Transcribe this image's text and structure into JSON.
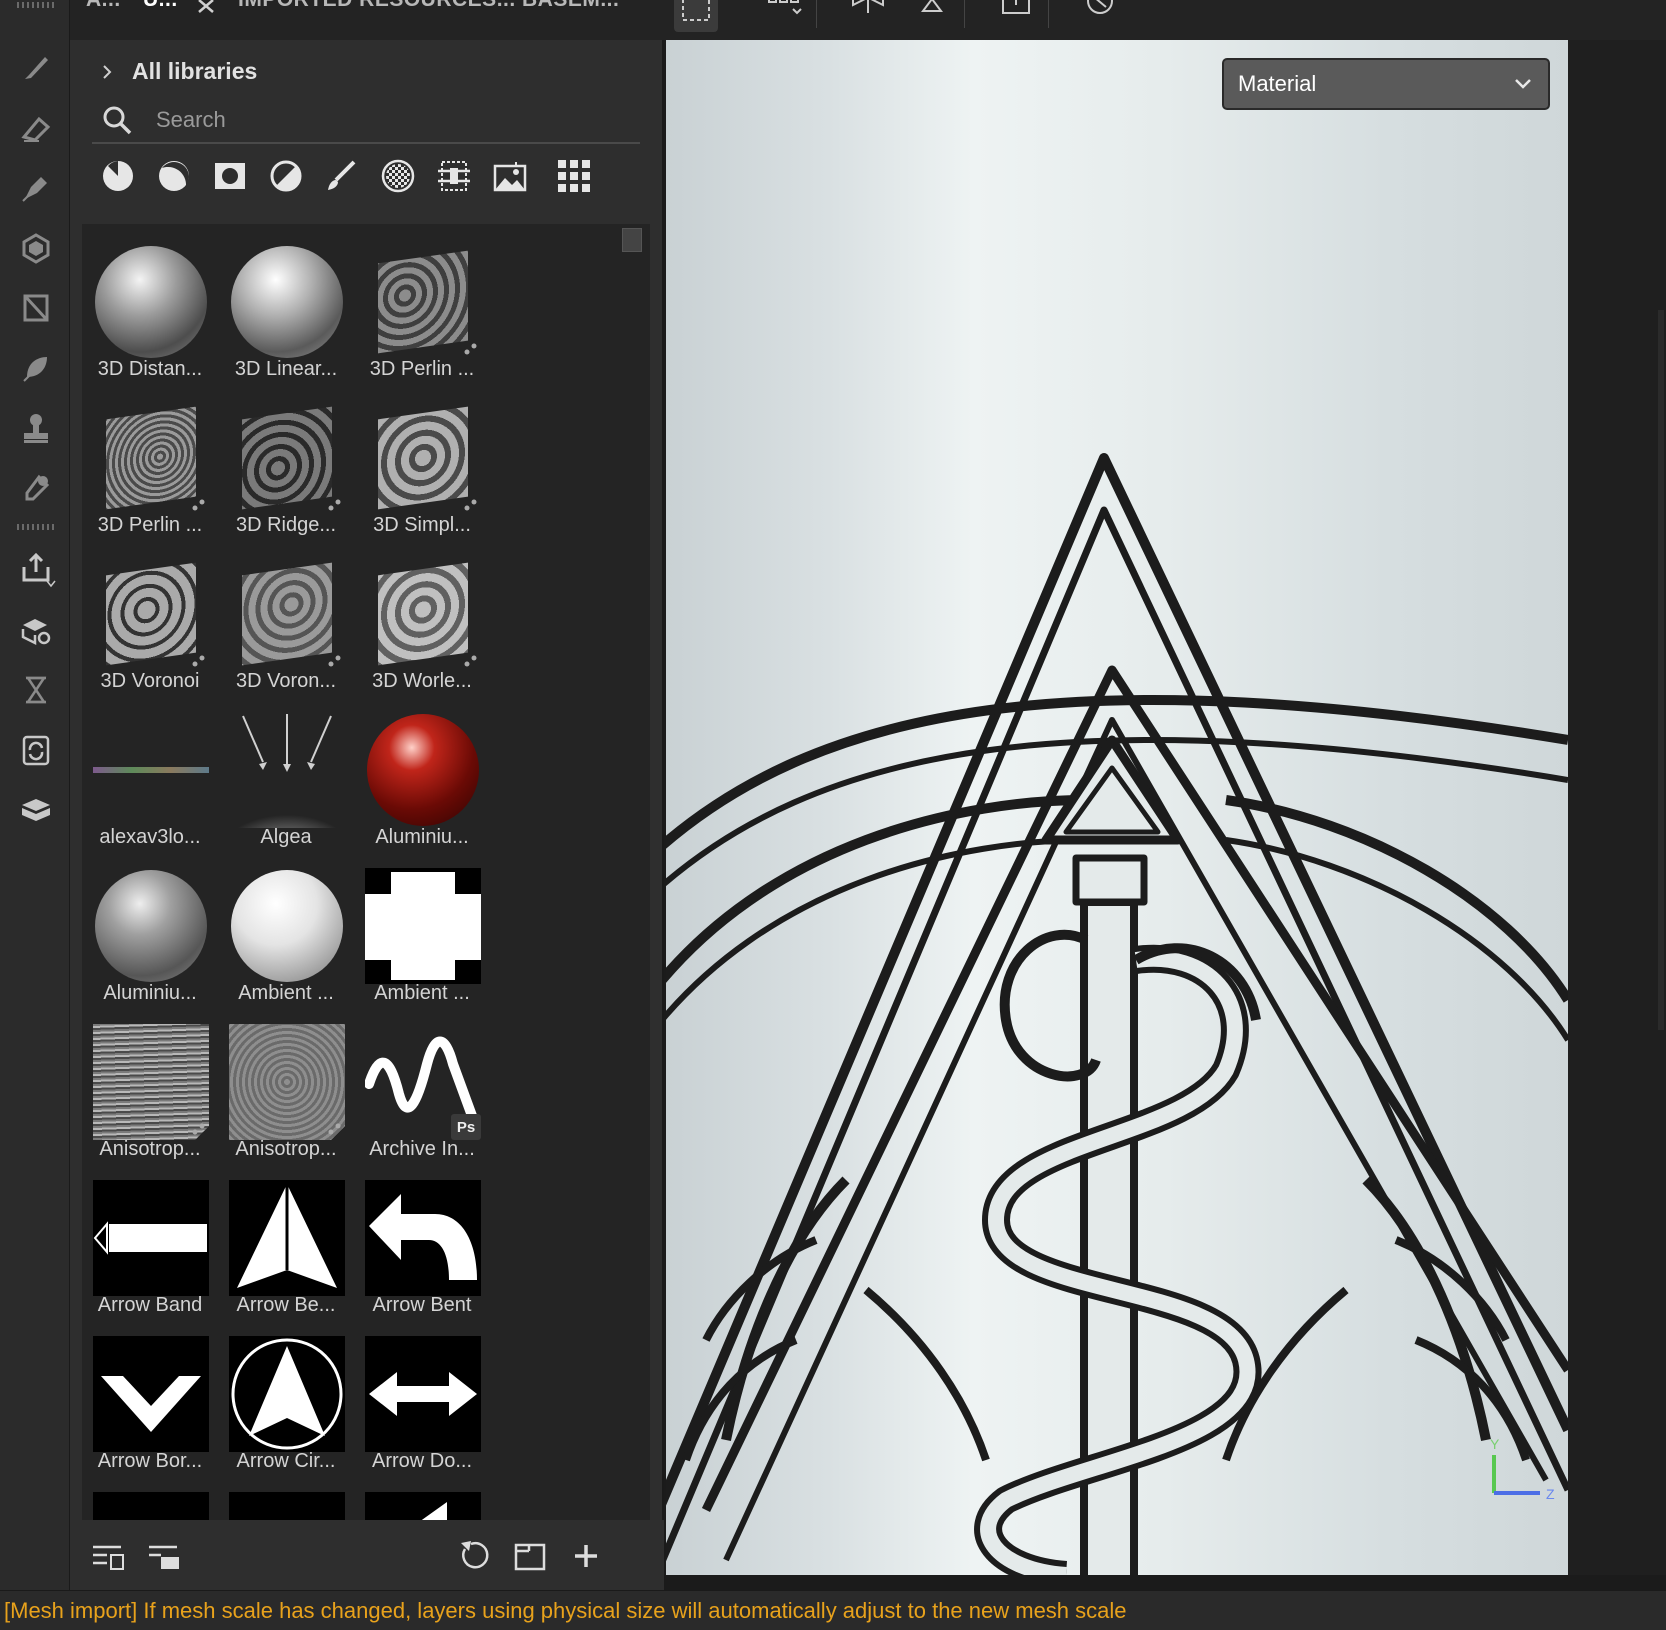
{
  "tabs": [
    {
      "label": "A...",
      "active": false
    },
    {
      "label": "U...",
      "active": true
    },
    {
      "label": "IMPORTED RESOURCES...",
      "active": false
    },
    {
      "label": "BASEM...",
      "active": false
    }
  ],
  "tools": [
    {
      "name": "paint-brush-tool-icon"
    },
    {
      "name": "eraser-tool-icon"
    },
    {
      "name": "projection-tool-icon"
    },
    {
      "name": "polygon-fill-tool-icon"
    },
    {
      "name": "smudge-tool-icon"
    },
    {
      "name": "clone-tool-icon"
    },
    {
      "name": "color-picker-tool-icon"
    },
    {
      "name": "export-icon"
    },
    {
      "name": "bake-icon"
    },
    {
      "name": "history-icon"
    },
    {
      "name": "sync-icon"
    },
    {
      "name": "iray-icon"
    }
  ],
  "library": {
    "breadcrumb": "All libraries",
    "search_placeholder": "Search"
  },
  "filters": [
    "smart-material-filter-icon",
    "material-filter-icon",
    "smart-mask-filter-icon",
    "filter-filter-icon",
    "brush-filter-icon",
    "particles-filter-icon",
    "tools-filter-icon",
    "environment-filter-icon",
    "all-types-filter-icon"
  ],
  "assets": [
    {
      "label": "3D Distan...",
      "kind": "sphere"
    },
    {
      "label": "3D Linear...",
      "kind": "sphere"
    },
    {
      "label": "3D Perlin ...",
      "kind": "cube"
    },
    {
      "label": "3D Perlin ...",
      "kind": "cube"
    },
    {
      "label": "3D Ridge...",
      "kind": "cube"
    },
    {
      "label": "3D Simpl...",
      "kind": "cube"
    },
    {
      "label": "3D Voronoi",
      "kind": "cube"
    },
    {
      "label": "3D Voron...",
      "kind": "cube"
    },
    {
      "label": "3D Worle...",
      "kind": "cube"
    },
    {
      "label": "alexav3lo...",
      "kind": "line"
    },
    {
      "label": "Algea",
      "kind": "arrows"
    },
    {
      "label": "Aluminiu...",
      "kind": "redsphere"
    },
    {
      "label": "Aluminiu...",
      "kind": "sphere"
    },
    {
      "label": "Ambient ...",
      "kind": "whitesphere"
    },
    {
      "label": "Ambient ...",
      "kind": "mask"
    },
    {
      "label": "Anisotrop...",
      "kind": "brushed"
    },
    {
      "label": "Anisotrop...",
      "kind": "swirl"
    },
    {
      "label": "Archive In...",
      "kind": "stroke"
    },
    {
      "label": "Arrow Band",
      "kind": "arrow-band"
    },
    {
      "label": "Arrow Be...",
      "kind": "arrow-bevel"
    },
    {
      "label": "Arrow Bent",
      "kind": "arrow-bent"
    },
    {
      "label": "Arrow Bor...",
      "kind": "arrow-border"
    },
    {
      "label": "Arrow Cir...",
      "kind": "arrow-circle"
    },
    {
      "label": "Arrow Do...",
      "kind": "arrow-double"
    },
    {
      "label": "",
      "kind": "black"
    },
    {
      "label": "",
      "kind": "black"
    },
    {
      "label": "",
      "kind": "black-corner"
    }
  ],
  "viewport": {
    "dropdown_value": "Material",
    "axis_labels": {
      "y": "Y",
      "z": "Z"
    }
  },
  "status": {
    "message": "[Mesh import] If mesh scale has changed, layers using physical size will automatically adjust to the new mesh scale",
    "color": "#e8a21c"
  }
}
